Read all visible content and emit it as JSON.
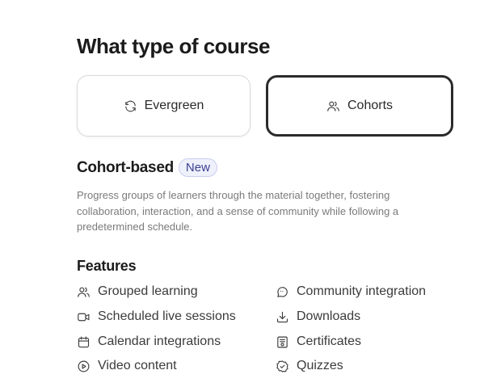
{
  "header": {
    "title": "What type of course"
  },
  "course_types": [
    {
      "label": "Evergreen",
      "icon": "refresh-icon",
      "selected": false
    },
    {
      "label": "Cohorts",
      "icon": "users-icon",
      "selected": true
    }
  ],
  "section": {
    "title": "Cohort-based",
    "badge": "New",
    "description": "Progress groups of learners through the material together, fostering collaboration, interaction, and a sense of community while following a predetermined schedule."
  },
  "features": {
    "title": "Features",
    "items": [
      {
        "label": "Grouped learning",
        "icon": "users-icon"
      },
      {
        "label": "Community integration",
        "icon": "chat-icon"
      },
      {
        "label": "Scheduled live sessions",
        "icon": "video-camera-icon"
      },
      {
        "label": "Downloads",
        "icon": "download-icon"
      },
      {
        "label": "Calendar integrations",
        "icon": "calendar-icon"
      },
      {
        "label": "Certificates",
        "icon": "certificate-icon"
      },
      {
        "label": "Video content",
        "icon": "play-circle-icon"
      },
      {
        "label": "Quizzes",
        "icon": "badge-check-icon"
      }
    ]
  }
}
